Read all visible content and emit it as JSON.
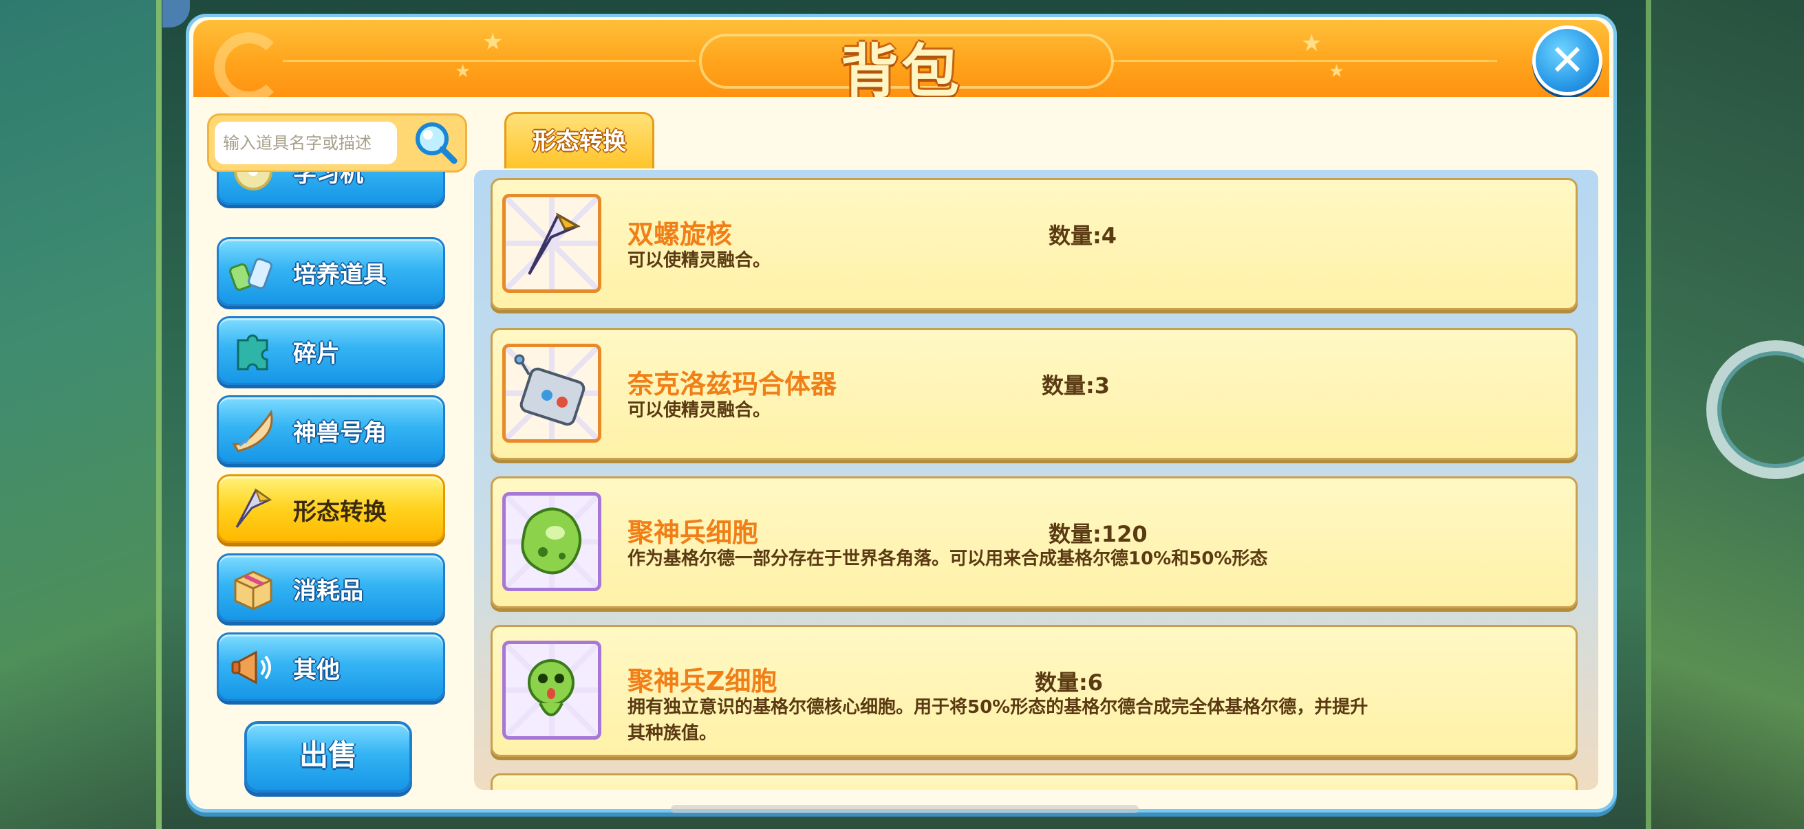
{
  "window": {
    "title": "背包",
    "close_icon": "close-icon"
  },
  "search": {
    "placeholder": "输入道具名字或描述",
    "icon": "magnifier-icon"
  },
  "categories": [
    {
      "label": "学习机",
      "icon": "disc-icon",
      "active": false
    },
    {
      "label": "培养道具",
      "icon": "potion-icon",
      "active": false
    },
    {
      "label": "碎片",
      "icon": "puzzle-piece-icon",
      "active": false
    },
    {
      "label": "神兽号角",
      "icon": "horn-icon",
      "active": false
    },
    {
      "label": "形态转换",
      "icon": "blade-icon",
      "active": true
    },
    {
      "label": "消耗品",
      "icon": "box-icon",
      "active": false
    },
    {
      "label": "其他",
      "icon": "megaphone-icon",
      "active": false
    }
  ],
  "sell_button": {
    "label": "出售"
  },
  "tab": {
    "label": "形态转换"
  },
  "items": [
    {
      "name": "双螺旋核",
      "count": "数量:4",
      "desc": "可以使精灵融合。",
      "icon": "blade-icon",
      "frame": "orange"
    },
    {
      "name": "奈克洛兹玛合体器",
      "count": "数量:3",
      "desc": "可以使精灵融合。",
      "icon": "device-icon",
      "frame": "orange"
    },
    {
      "name": "聚神兵细胞",
      "count": "数量:120",
      "desc": "作为基格尔德一部分存在于世界各角落。可以用来合成基格尔德10%和50%形态",
      "icon": "green-cell-icon",
      "frame": "purple"
    },
    {
      "name": "聚神兵Z细胞",
      "count": "数量:6",
      "desc": "拥有独立意识的基格尔德核心细胞。用于将50%形态的基格尔德合成完全体基格尔德，并提升其种族值。",
      "icon": "z-core-icon",
      "frame": "purple"
    }
  ],
  "colors": {
    "accent_orange": "#ff9f1a",
    "button_blue": "#1696e6",
    "active_yellow": "#ffd21e",
    "item_name": "#f07f18"
  }
}
